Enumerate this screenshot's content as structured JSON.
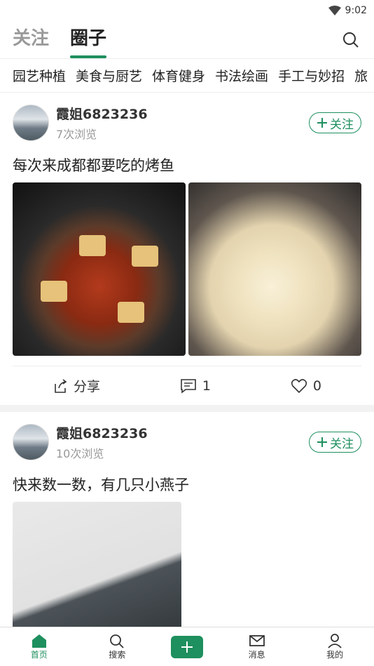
{
  "status": {
    "time": "9:02"
  },
  "header": {
    "tabs": [
      {
        "label": "关注"
      },
      {
        "label": "圈子"
      }
    ]
  },
  "categories": [
    "园艺种植",
    "美食与厨艺",
    "体育健身",
    "书法绘画",
    "手工与妙招",
    "旅"
  ],
  "posts": [
    {
      "user": "霞姐6823236",
      "views": "7次浏览",
      "follow": "关注",
      "text": "每次来成都都要吃的烤鱼",
      "share": "分享",
      "comments": "1",
      "likes": "0"
    },
    {
      "user": "霞姐6823236",
      "views": "10次浏览",
      "follow": "关注",
      "text": "快来数一数，有几只小燕子"
    }
  ],
  "nav": {
    "home": "首页",
    "search": "搜索",
    "messages": "消息",
    "mine": "我的"
  },
  "colors": {
    "accent": "#1e8f5e"
  }
}
